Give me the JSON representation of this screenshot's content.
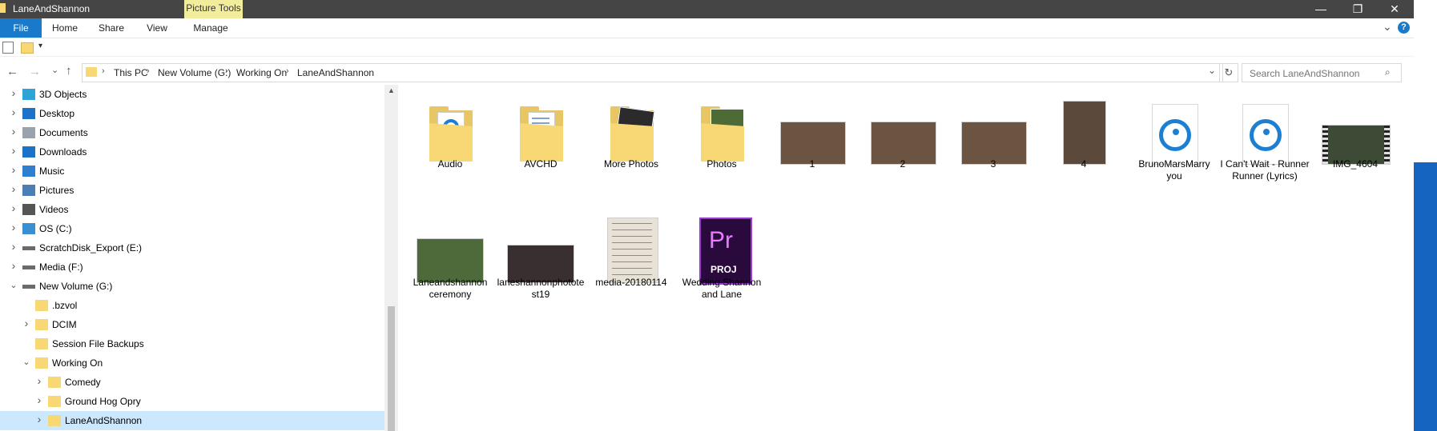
{
  "window": {
    "title": "LaneAndShannon",
    "context_tab": "Picture Tools",
    "minimize_glyph": "—",
    "maximize_glyph": "❐",
    "close_glyph": "✕"
  },
  "ribbon": {
    "tabs": [
      "File",
      "Home",
      "Share",
      "View",
      "Manage"
    ],
    "expand_glyph": "⌄",
    "help_glyph": "?"
  },
  "address": {
    "segments": [
      "This PC",
      "New Volume (G:)",
      "Working On",
      "LaneAndShannon"
    ],
    "dropdown_glyph": "⌄",
    "refresh_glyph": "↻"
  },
  "search": {
    "placeholder": "Search LaneAndShannon"
  },
  "nav_pane": {
    "items": [
      {
        "label": "3D Objects",
        "icon": "3d-objects-icon",
        "expanded": false,
        "indent": 0
      },
      {
        "label": "Desktop",
        "icon": "desktop-icon",
        "expanded": false,
        "indent": 0
      },
      {
        "label": "Documents",
        "icon": "documents-icon",
        "expanded": false,
        "indent": 0
      },
      {
        "label": "Downloads",
        "icon": "downloads-icon",
        "expanded": false,
        "indent": 0
      },
      {
        "label": "Music",
        "icon": "music-icon",
        "expanded": false,
        "indent": 0
      },
      {
        "label": "Pictures",
        "icon": "pictures-icon",
        "expanded": false,
        "indent": 0
      },
      {
        "label": "Videos",
        "icon": "videos-icon",
        "expanded": false,
        "indent": 0
      },
      {
        "label": "OS (C:)",
        "icon": "os-drive-icon",
        "expanded": false,
        "indent": 0
      },
      {
        "label": "ScratchDisk_Export (E:)",
        "icon": "drive-icon",
        "expanded": false,
        "indent": 0
      },
      {
        "label": "Media (F:)",
        "icon": "drive-icon",
        "expanded": false,
        "indent": 0
      },
      {
        "label": "New Volume (G:)",
        "icon": "drive-icon",
        "expanded": true,
        "indent": 0
      },
      {
        "label": ".bzvol",
        "icon": "folder-icon",
        "expanded": null,
        "indent": 1
      },
      {
        "label": "DCIM",
        "icon": "folder-icon",
        "expanded": false,
        "indent": 1
      },
      {
        "label": "Session File Backups",
        "icon": "folder-icon",
        "expanded": null,
        "indent": 1
      },
      {
        "label": "Working On",
        "icon": "folder-icon",
        "expanded": true,
        "indent": 1
      },
      {
        "label": "Comedy",
        "icon": "folder-icon",
        "expanded": false,
        "indent": 2
      },
      {
        "label": "Ground Hog Opry",
        "icon": "folder-icon",
        "expanded": false,
        "indent": 2
      },
      {
        "label": "LaneAndShannon",
        "icon": "folder-icon",
        "expanded": false,
        "indent": 2,
        "selected": true
      }
    ]
  },
  "files": [
    {
      "name": "Audio",
      "kind": "folder-audio"
    },
    {
      "name": "AVCHD",
      "kind": "folder-docs"
    },
    {
      "name": "More Photos",
      "kind": "folder-photos-dark"
    },
    {
      "name": "Photos",
      "kind": "folder-photos-green"
    },
    {
      "name": "1",
      "kind": "photo-landscape"
    },
    {
      "name": "2",
      "kind": "photo-landscape"
    },
    {
      "name": "3",
      "kind": "photo-landscape"
    },
    {
      "name": "4",
      "kind": "photo-portrait"
    },
    {
      "name": "BrunoMarsMarry you",
      "kind": "audio-file"
    },
    {
      "name": "I Can't Wait - Runner Runner (Lyrics)",
      "kind": "audio-file"
    },
    {
      "name": "IMG_4604",
      "kind": "video-file"
    },
    {
      "name": "Laneandshannon ceremony",
      "kind": "photo-landscape-green"
    },
    {
      "name": "laneshannonphototest19",
      "kind": "photo-landscape-dark"
    },
    {
      "name": "media-20180114",
      "kind": "photo-handwriting"
    },
    {
      "name": "Wedding Shannon and Lane",
      "kind": "premiere-project",
      "badge": "Pr",
      "badge_sub": "PROJ"
    }
  ],
  "colors": {
    "titlebar": "#454545",
    "context_tab": "#f2ec9d",
    "file_tab": "#1979ca",
    "selection": "#cce8ff",
    "folder": "#f8d775",
    "groove_blue": "#1d7fd1",
    "premiere_purple": "#2a0a3d",
    "premiere_text": "#e77cff"
  }
}
